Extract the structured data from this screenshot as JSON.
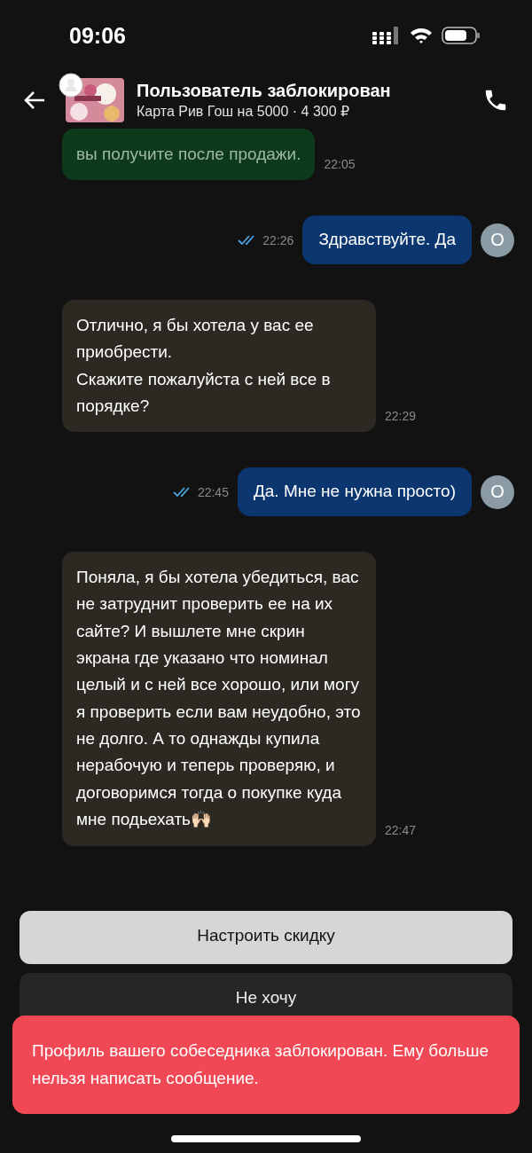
{
  "status_bar": {
    "time": "09:06"
  },
  "header": {
    "title": "Пользователь заблокирован",
    "subtitle": "Карта Рив Гош на 5000 · 4 300 ₽"
  },
  "messages": [
    {
      "kind": "system",
      "text": "вы получите после продажи.",
      "time": "22:05"
    },
    {
      "kind": "outgoing",
      "text": "Здравствуйте. Да",
      "time": "22:26",
      "read": true,
      "avatar": "О"
    },
    {
      "kind": "incoming",
      "text": "Отлично, я бы хотела у вас ее приобрести.\nСкажите пожалуйста с ней все в порядке?",
      "time": "22:29"
    },
    {
      "kind": "outgoing",
      "text": "Да. Мне не нужна просто)",
      "time": "22:45",
      "read": true,
      "avatar": "О"
    },
    {
      "kind": "incoming",
      "text": "Поняла, я бы хотела убедиться, вас не затруднит проверить ее на их сайте? И вышлете мне скрин экрана где указано что номинал целый и с ней все хорошо, или могу я проверить если вам неудобно, это не долго. А то однажды купила нерабочую и теперь проверяю, и договоримся тогда о покупке куда мне подьехать🙌🏻",
      "time": "22:47"
    }
  ],
  "actions": [
    {
      "label": "Настроить скидку",
      "kind": "primary"
    },
    {
      "label": "Не хочу",
      "kind": "secondary"
    }
  ],
  "toast": {
    "text": "Профиль вашего собеседника заблокирован. Ему больше нельзя написать сообщение."
  }
}
